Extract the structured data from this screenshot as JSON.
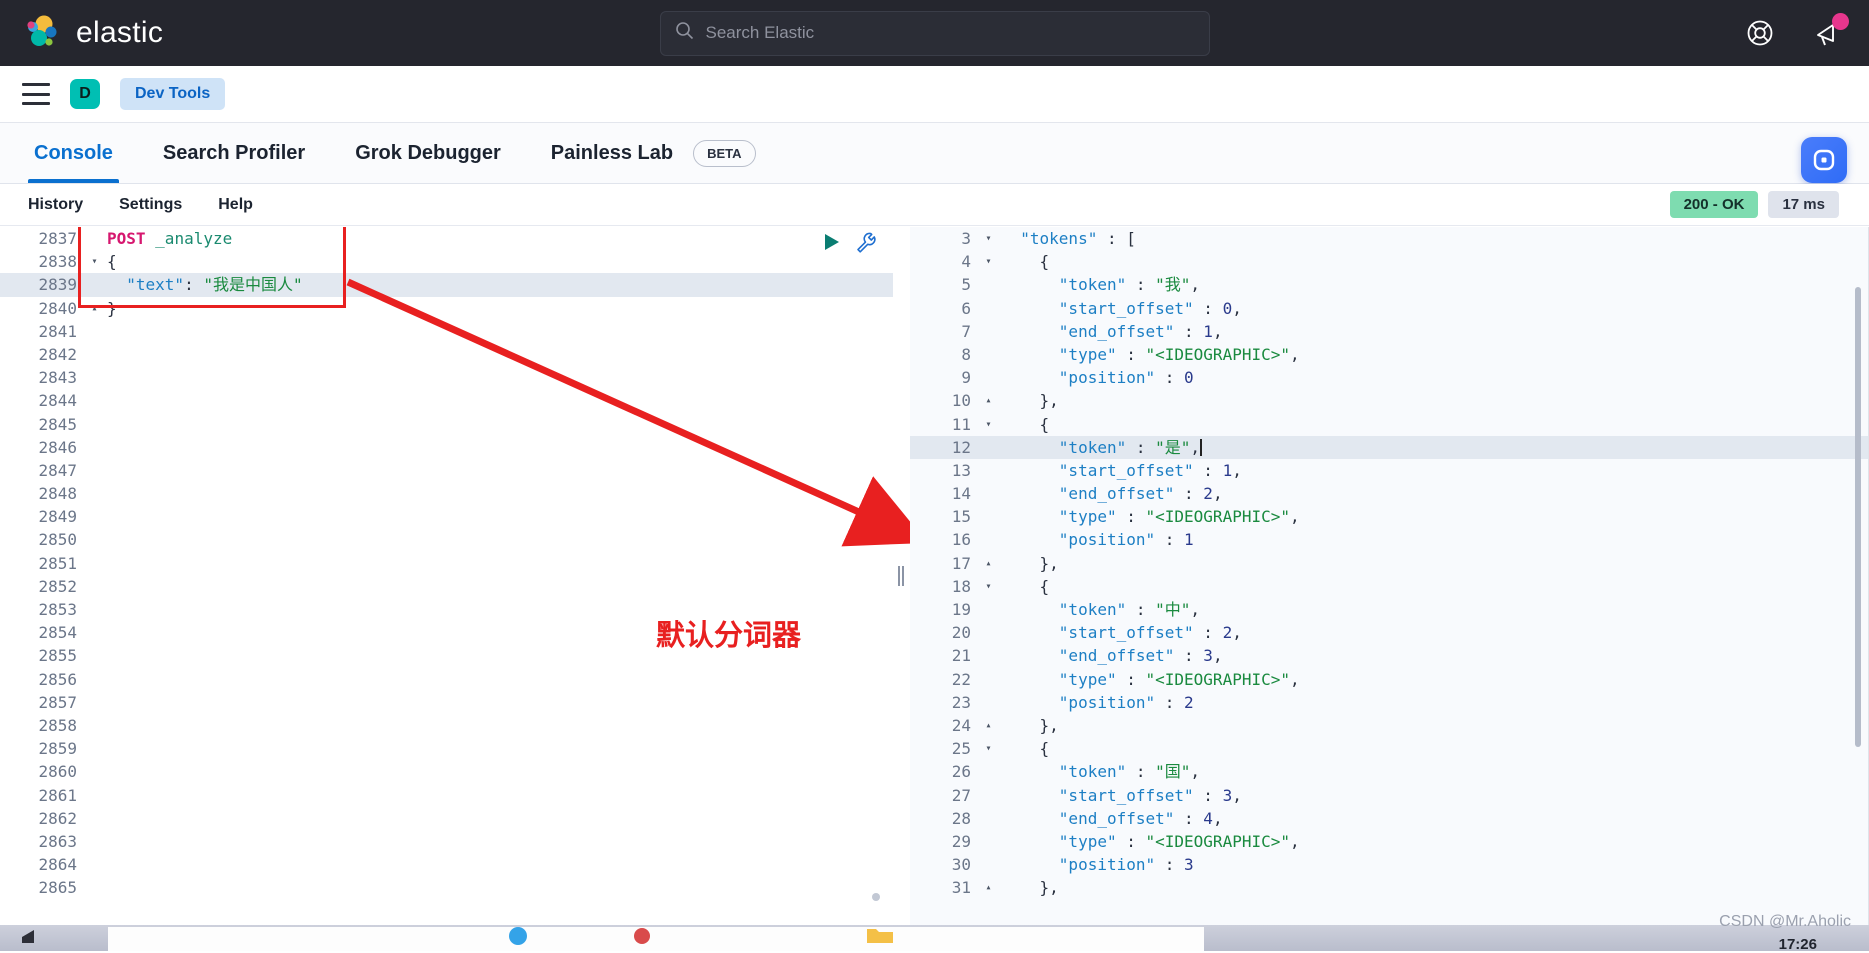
{
  "header": {
    "brand_name": "elastic",
    "logo_icon": "elastic-logo-icon",
    "search": {
      "placeholder": "Search Elastic",
      "value": "",
      "icon": "search-icon"
    },
    "help_icon": "lifebuoy-help-icon",
    "announcement_icon": "megaphone-announcement-icon",
    "has_notification": true,
    "bg_color": "#25262e"
  },
  "nav": {
    "menu_icon": "hamburger-menu-icon",
    "avatar_label": "D",
    "avatar_color": "#00bfb3",
    "breadcrumb": "Dev Tools"
  },
  "tabs": {
    "items": [
      {
        "label": "Console",
        "active": true
      },
      {
        "label": "Search Profiler",
        "active": false
      },
      {
        "label": "Grok Debugger",
        "active": false
      },
      {
        "label": "Painless Lab",
        "active": false
      }
    ],
    "beta_badge": "BETA",
    "active_color": "#0a70cf",
    "chat_widget_icon": "chat-support-icon"
  },
  "toolbar": {
    "links": [
      "History",
      "Settings",
      "Help"
    ],
    "status_code": "200 - OK",
    "status_color": "#7edcb0",
    "duration": "17 ms"
  },
  "request_editor": {
    "first_line_number": 2837,
    "total_visible_lines": 22,
    "run_icon": "play-run-icon",
    "wrench_icon": "wrench-settings-icon",
    "highlighted_line": 2839,
    "lines": [
      {
        "n": 2837,
        "fold": "",
        "tokens": [
          {
            "t": "POST ",
            "c": "k-method"
          },
          {
            "t": "_analyze",
            "c": "k-url"
          }
        ]
      },
      {
        "n": 2838,
        "fold": "▾",
        "tokens": [
          {
            "t": "{",
            "c": "k-punct"
          }
        ]
      },
      {
        "n": 2839,
        "fold": "",
        "tokens": [
          {
            "t": "  ",
            "c": "k-punct"
          },
          {
            "t": "\"text\"",
            "c": "k-key"
          },
          {
            "t": ": ",
            "c": "k-punct"
          },
          {
            "t": "\"我是中国人\"",
            "c": "k-str"
          }
        ]
      },
      {
        "n": 2840,
        "fold": "▴",
        "tokens": [
          {
            "t": "}",
            "c": "k-punct"
          }
        ]
      },
      {
        "n": 2841,
        "fold": "",
        "tokens": []
      },
      {
        "n": 2842,
        "fold": "",
        "tokens": []
      },
      {
        "n": 2843,
        "fold": "",
        "tokens": []
      },
      {
        "n": 2844,
        "fold": "",
        "tokens": []
      },
      {
        "n": 2845,
        "fold": "",
        "tokens": []
      },
      {
        "n": 2846,
        "fold": "",
        "tokens": []
      },
      {
        "n": 2847,
        "fold": "",
        "tokens": []
      },
      {
        "n": 2848,
        "fold": "",
        "tokens": []
      },
      {
        "n": 2849,
        "fold": "",
        "tokens": []
      },
      {
        "n": 2850,
        "fold": "",
        "tokens": []
      },
      {
        "n": 2851,
        "fold": "",
        "tokens": []
      },
      {
        "n": 2852,
        "fold": "",
        "tokens": []
      },
      {
        "n": 2853,
        "fold": "",
        "tokens": []
      },
      {
        "n": 2854,
        "fold": "",
        "tokens": []
      },
      {
        "n": 2855,
        "fold": "",
        "tokens": []
      },
      {
        "n": 2856,
        "fold": "",
        "tokens": []
      },
      {
        "n": 2857,
        "fold": "",
        "tokens": []
      },
      {
        "n": 2858,
        "fold": "",
        "tokens": []
      },
      {
        "n": 2859,
        "fold": "",
        "tokens": []
      },
      {
        "n": 2860,
        "fold": "",
        "tokens": []
      },
      {
        "n": 2861,
        "fold": "",
        "tokens": []
      },
      {
        "n": 2862,
        "fold": "",
        "tokens": []
      },
      {
        "n": 2863,
        "fold": "",
        "tokens": []
      },
      {
        "n": 2864,
        "fold": "",
        "tokens": []
      },
      {
        "n": 2865,
        "fold": "",
        "tokens": []
      }
    ]
  },
  "annotation": {
    "text": "默认分词器",
    "color": "#e82020",
    "arrow": "red-arrow-pointing-right-down"
  },
  "response_editor": {
    "highlighted_line": 12,
    "lines": [
      {
        "n": 3,
        "fold": "▾",
        "tokens": [
          {
            "t": "  ",
            "c": "k-punct"
          },
          {
            "t": "\"tokens\"",
            "c": "k-key"
          },
          {
            "t": " : [",
            "c": "k-punct"
          }
        ]
      },
      {
        "n": 4,
        "fold": "▾",
        "tokens": [
          {
            "t": "    {",
            "c": "k-punct"
          }
        ]
      },
      {
        "n": 5,
        "fold": "",
        "tokens": [
          {
            "t": "      ",
            "c": "k-punct"
          },
          {
            "t": "\"token\"",
            "c": "k-key"
          },
          {
            "t": " : ",
            "c": "k-punct"
          },
          {
            "t": "\"我\"",
            "c": "k-str"
          },
          {
            "t": ",",
            "c": "k-punct"
          }
        ]
      },
      {
        "n": 6,
        "fold": "",
        "tokens": [
          {
            "t": "      ",
            "c": "k-punct"
          },
          {
            "t": "\"start_offset\"",
            "c": "k-key"
          },
          {
            "t": " : ",
            "c": "k-punct"
          },
          {
            "t": "0",
            "c": "k-num"
          },
          {
            "t": ",",
            "c": "k-punct"
          }
        ]
      },
      {
        "n": 7,
        "fold": "",
        "tokens": [
          {
            "t": "      ",
            "c": "k-punct"
          },
          {
            "t": "\"end_offset\"",
            "c": "k-key"
          },
          {
            "t": " : ",
            "c": "k-punct"
          },
          {
            "t": "1",
            "c": "k-num"
          },
          {
            "t": ",",
            "c": "k-punct"
          }
        ]
      },
      {
        "n": 8,
        "fold": "",
        "tokens": [
          {
            "t": "      ",
            "c": "k-punct"
          },
          {
            "t": "\"type\"",
            "c": "k-key"
          },
          {
            "t": " : ",
            "c": "k-punct"
          },
          {
            "t": "\"<IDEOGRAPHIC>\"",
            "c": "k-str"
          },
          {
            "t": ",",
            "c": "k-punct"
          }
        ]
      },
      {
        "n": 9,
        "fold": "",
        "tokens": [
          {
            "t": "      ",
            "c": "k-punct"
          },
          {
            "t": "\"position\"",
            "c": "k-key"
          },
          {
            "t": " : ",
            "c": "k-punct"
          },
          {
            "t": "0",
            "c": "k-num"
          }
        ]
      },
      {
        "n": 10,
        "fold": "▴",
        "tokens": [
          {
            "t": "    },",
            "c": "k-punct"
          }
        ]
      },
      {
        "n": 11,
        "fold": "▾",
        "tokens": [
          {
            "t": "    {",
            "c": "k-punct"
          }
        ]
      },
      {
        "n": 12,
        "fold": "",
        "tokens": [
          {
            "t": "      ",
            "c": "k-punct"
          },
          {
            "t": "\"token\"",
            "c": "k-key"
          },
          {
            "t": " : ",
            "c": "k-punct"
          },
          {
            "t": "\"是\"",
            "c": "k-str"
          },
          {
            "t": ",",
            "c": "k-punct"
          }
        ]
      },
      {
        "n": 13,
        "fold": "",
        "tokens": [
          {
            "t": "      ",
            "c": "k-punct"
          },
          {
            "t": "\"start_offset\"",
            "c": "k-key"
          },
          {
            "t": " : ",
            "c": "k-punct"
          },
          {
            "t": "1",
            "c": "k-num"
          },
          {
            "t": ",",
            "c": "k-punct"
          }
        ]
      },
      {
        "n": 14,
        "fold": "",
        "tokens": [
          {
            "t": "      ",
            "c": "k-punct"
          },
          {
            "t": "\"end_offset\"",
            "c": "k-key"
          },
          {
            "t": " : ",
            "c": "k-punct"
          },
          {
            "t": "2",
            "c": "k-num"
          },
          {
            "t": ",",
            "c": "k-punct"
          }
        ]
      },
      {
        "n": 15,
        "fold": "",
        "tokens": [
          {
            "t": "      ",
            "c": "k-punct"
          },
          {
            "t": "\"type\"",
            "c": "k-key"
          },
          {
            "t": " : ",
            "c": "k-punct"
          },
          {
            "t": "\"<IDEOGRAPHIC>\"",
            "c": "k-str"
          },
          {
            "t": ",",
            "c": "k-punct"
          }
        ]
      },
      {
        "n": 16,
        "fold": "",
        "tokens": [
          {
            "t": "      ",
            "c": "k-punct"
          },
          {
            "t": "\"position\"",
            "c": "k-key"
          },
          {
            "t": " : ",
            "c": "k-punct"
          },
          {
            "t": "1",
            "c": "k-num"
          }
        ]
      },
      {
        "n": 17,
        "fold": "▴",
        "tokens": [
          {
            "t": "    },",
            "c": "k-punct"
          }
        ]
      },
      {
        "n": 18,
        "fold": "▾",
        "tokens": [
          {
            "t": "    {",
            "c": "k-punct"
          }
        ]
      },
      {
        "n": 19,
        "fold": "",
        "tokens": [
          {
            "t": "      ",
            "c": "k-punct"
          },
          {
            "t": "\"token\"",
            "c": "k-key"
          },
          {
            "t": " : ",
            "c": "k-punct"
          },
          {
            "t": "\"中\"",
            "c": "k-str"
          },
          {
            "t": ",",
            "c": "k-punct"
          }
        ]
      },
      {
        "n": 20,
        "fold": "",
        "tokens": [
          {
            "t": "      ",
            "c": "k-punct"
          },
          {
            "t": "\"start_offset\"",
            "c": "k-key"
          },
          {
            "t": " : ",
            "c": "k-punct"
          },
          {
            "t": "2",
            "c": "k-num"
          },
          {
            "t": ",",
            "c": "k-punct"
          }
        ]
      },
      {
        "n": 21,
        "fold": "",
        "tokens": [
          {
            "t": "      ",
            "c": "k-punct"
          },
          {
            "t": "\"end_offset\"",
            "c": "k-key"
          },
          {
            "t": " : ",
            "c": "k-punct"
          },
          {
            "t": "3",
            "c": "k-num"
          },
          {
            "t": ",",
            "c": "k-punct"
          }
        ]
      },
      {
        "n": 22,
        "fold": "",
        "tokens": [
          {
            "t": "      ",
            "c": "k-punct"
          },
          {
            "t": "\"type\"",
            "c": "k-key"
          },
          {
            "t": " : ",
            "c": "k-punct"
          },
          {
            "t": "\"<IDEOGRAPHIC>\"",
            "c": "k-str"
          },
          {
            "t": ",",
            "c": "k-punct"
          }
        ]
      },
      {
        "n": 23,
        "fold": "",
        "tokens": [
          {
            "t": "      ",
            "c": "k-punct"
          },
          {
            "t": "\"position\"",
            "c": "k-key"
          },
          {
            "t": " : ",
            "c": "k-punct"
          },
          {
            "t": "2",
            "c": "k-num"
          }
        ]
      },
      {
        "n": 24,
        "fold": "▴",
        "tokens": [
          {
            "t": "    },",
            "c": "k-punct"
          }
        ]
      },
      {
        "n": 25,
        "fold": "▾",
        "tokens": [
          {
            "t": "    {",
            "c": "k-punct"
          }
        ]
      },
      {
        "n": 26,
        "fold": "",
        "tokens": [
          {
            "t": "      ",
            "c": "k-punct"
          },
          {
            "t": "\"token\"",
            "c": "k-key"
          },
          {
            "t": " : ",
            "c": "k-punct"
          },
          {
            "t": "\"国\"",
            "c": "k-str"
          },
          {
            "t": ",",
            "c": "k-punct"
          }
        ]
      },
      {
        "n": 27,
        "fold": "",
        "tokens": [
          {
            "t": "      ",
            "c": "k-punct"
          },
          {
            "t": "\"start_offset\"",
            "c": "k-key"
          },
          {
            "t": " : ",
            "c": "k-punct"
          },
          {
            "t": "3",
            "c": "k-num"
          },
          {
            "t": ",",
            "c": "k-punct"
          }
        ]
      },
      {
        "n": 28,
        "fold": "",
        "tokens": [
          {
            "t": "      ",
            "c": "k-punct"
          },
          {
            "t": "\"end_offset\"",
            "c": "k-key"
          },
          {
            "t": " : ",
            "c": "k-punct"
          },
          {
            "t": "4",
            "c": "k-num"
          },
          {
            "t": ",",
            "c": "k-punct"
          }
        ]
      },
      {
        "n": 29,
        "fold": "",
        "tokens": [
          {
            "t": "      ",
            "c": "k-punct"
          },
          {
            "t": "\"type\"",
            "c": "k-key"
          },
          {
            "t": " : ",
            "c": "k-punct"
          },
          {
            "t": "\"<IDEOGRAPHIC>\"",
            "c": "k-str"
          },
          {
            "t": ",",
            "c": "k-punct"
          }
        ]
      },
      {
        "n": 30,
        "fold": "",
        "tokens": [
          {
            "t": "      ",
            "c": "k-punct"
          },
          {
            "t": "\"position\"",
            "c": "k-key"
          },
          {
            "t": " : ",
            "c": "k-punct"
          },
          {
            "t": "3",
            "c": "k-num"
          }
        ]
      },
      {
        "n": 31,
        "fold": "▴",
        "tokens": [
          {
            "t": "    },",
            "c": "k-punct"
          }
        ]
      }
    ]
  },
  "taskbar": {
    "clock": "17:26",
    "watermark": "CSDN @Mr.Aholic"
  }
}
